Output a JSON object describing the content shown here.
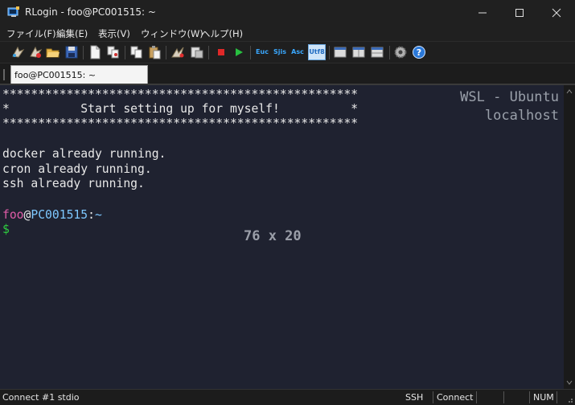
{
  "window": {
    "title": "RLogin - foo@PC001515: ~"
  },
  "menu": {
    "items": [
      "ファイル(F)",
      "編集(E)",
      "表示(V)",
      "ウィンドウ(W)",
      "ヘルプ(H)"
    ]
  },
  "toolbar": {
    "text_buttons": [
      "Euc",
      "Sjis",
      "Asc",
      "Utf8"
    ]
  },
  "tabs": [
    {
      "label": "foo@PC001515: ~"
    }
  ],
  "terminal": {
    "banner_top": "**************************************************",
    "banner_mid": "*          Start setting up for myself!          *",
    "banner_bottom": "**************************************************",
    "messages": [
      "docker already running.",
      "cron already running.",
      "ssh already running."
    ],
    "prompt_user": "foo",
    "prompt_at": "@",
    "prompt_host": "PC001515",
    "prompt_colon": ":",
    "prompt_path": "~",
    "prompt_symbol": "$",
    "host_info_1": "WSL - Ubuntu",
    "host_info_2": "localhost",
    "size_overlay": "76 x 20"
  },
  "status": {
    "left": "Connect #1 stdio",
    "ssh": "SSH",
    "connect": "Connect",
    "num": "NUM"
  },
  "colors": {
    "terminal_bg": "#1f2230",
    "prompt_user": "#e05ca8",
    "prompt_host": "#7ec8ff",
    "prompt_symbol": "#2ecc40"
  }
}
